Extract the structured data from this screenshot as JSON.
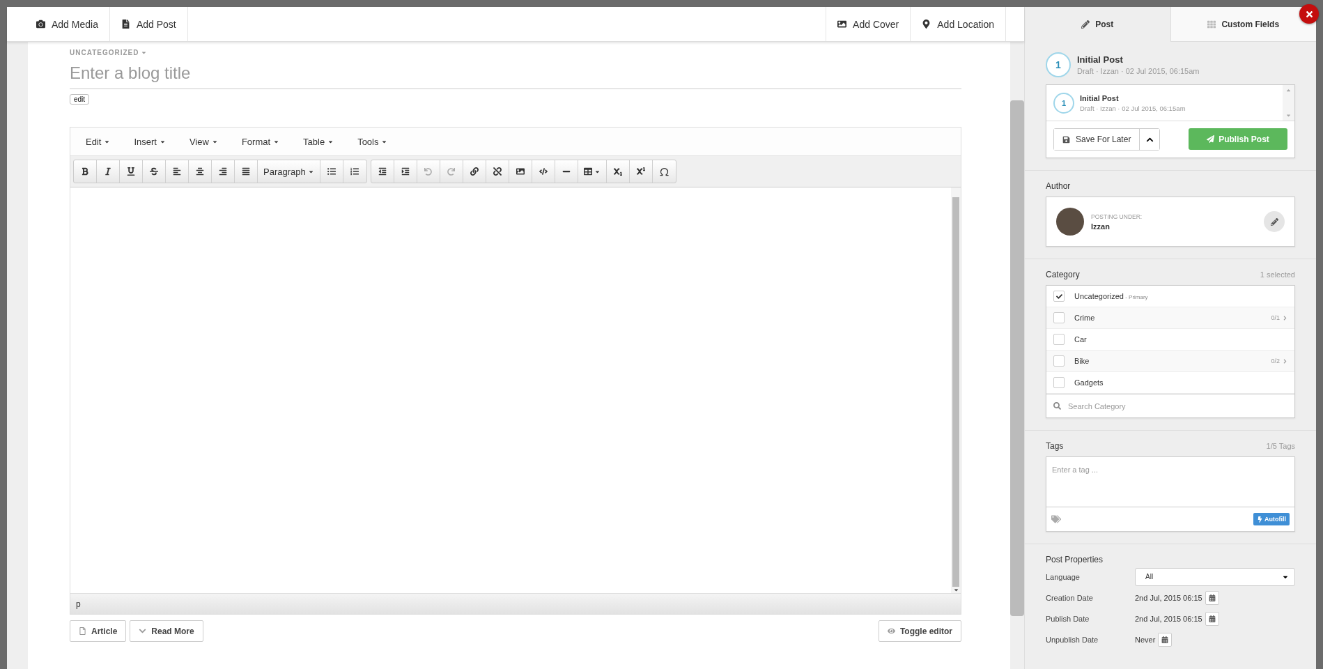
{
  "top_bar": {
    "left": [
      {
        "label": "Add Media"
      },
      {
        "label": "Add Post"
      }
    ],
    "right": [
      {
        "label": "Add Cover"
      },
      {
        "label": "Add Location"
      }
    ]
  },
  "editor": {
    "category_label": "UNCATEGORIZED",
    "title_placeholder": "Enter a blog title",
    "edit_button": "edit",
    "menus": [
      "Edit",
      "Insert",
      "View",
      "Format",
      "Table",
      "Tools"
    ],
    "format_select": "Paragraph",
    "history": {
      "undo_disabled": true,
      "redo_disabled": true
    },
    "status_path": "p",
    "bottom_left": [
      "Article",
      "Read More"
    ],
    "toggle_button": "Toggle editor"
  },
  "sidebar": {
    "tabs": [
      {
        "label": "Post",
        "selected": true
      },
      {
        "label": "Custom Fields",
        "selected": false
      }
    ],
    "revision": {
      "number": "1",
      "title": "Initial Post",
      "meta": "Draft · Izzan · 02 Jul 2015, 06:15am"
    },
    "revision_list": [
      {
        "number": "1",
        "title": "Initial Post",
        "meta": "Draft · Izzan · 02 Jul 2015, 06:15am"
      }
    ],
    "save_button": "Save For Later",
    "publish_button": "Publish Post",
    "author": {
      "heading": "Author",
      "caption": "POSTING UNDER:",
      "name": "Izzan"
    },
    "category": {
      "heading": "Category",
      "count": "1 selected",
      "search_placeholder": "Search Category",
      "items": [
        {
          "label": "Uncategorized",
          "note": "- Primary",
          "checked": true
        },
        {
          "label": "Crime",
          "checked": false,
          "sub_count": "0/1"
        },
        {
          "label": "Car",
          "checked": false
        },
        {
          "label": "Bike",
          "checked": false,
          "sub_count": "0/2"
        },
        {
          "label": "Gadgets",
          "checked": false
        }
      ]
    },
    "tags": {
      "heading": "Tags",
      "count": "1/5 Tags",
      "placeholder": "Enter a tag ...",
      "autofill": "Autofill"
    },
    "properties": {
      "heading": "Post Properties",
      "rows": [
        {
          "kind": "select",
          "label": "Language",
          "value": "All"
        },
        {
          "kind": "date",
          "label": "Creation Date",
          "value": "2nd Jul, 2015 06:15"
        },
        {
          "kind": "date",
          "label": "Publish Date",
          "value": "2nd Jul, 2015 06:15"
        },
        {
          "kind": "date",
          "label": "Unpublish Date",
          "value": "Never"
        }
      ]
    }
  }
}
